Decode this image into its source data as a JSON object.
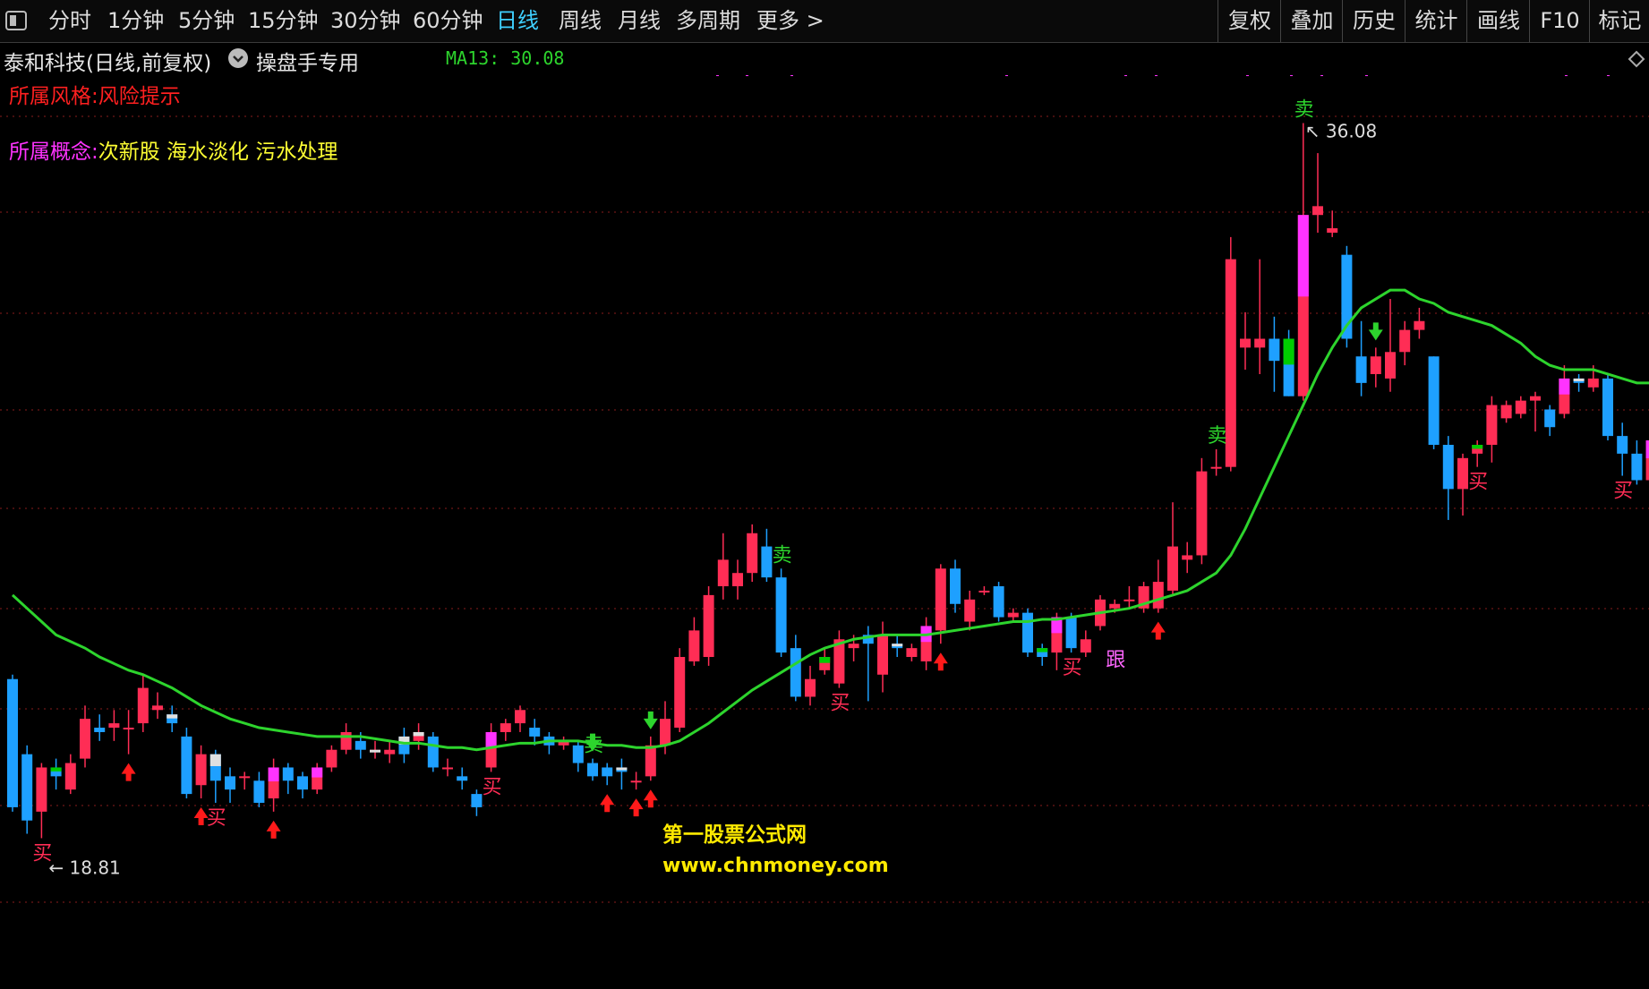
{
  "toolbar": {
    "periods": [
      "分时",
      "1分钟",
      "5分钟",
      "15分钟",
      "30分钟",
      "60分钟",
      "日线",
      "周线",
      "月线",
      "多周期",
      "更多 >"
    ],
    "active_period": "日线",
    "right_buttons": [
      "复权",
      "叠加",
      "历史",
      "统计",
      "画线",
      "F10",
      "标记"
    ]
  },
  "info": {
    "title": "泰和科技(日线,前复权)",
    "special": "操盘手专用",
    "ma_label": "MA13: 30.08"
  },
  "notes": {
    "style_prefix": "所属风格:",
    "style_value": "风险提示",
    "concept_prefix": "所属概念:",
    "concept_value": "次新股 海水淡化 污水处理"
  },
  "colors": {
    "up": "#ff2d55",
    "down": "#1ea0ff",
    "ma": "#2dd42d",
    "buy_arrow": "#ff1a1a",
    "sell_arrow": "#2dd42d",
    "grid": "#8a1c1c",
    "highlight_magenta": "#ff33ff",
    "highlight_green": "#00cc00"
  },
  "chart_data": {
    "type": "candlestick",
    "y_min": 17.5,
    "y_max": 38.5,
    "max_label": "36.08",
    "min_label": "18.81",
    "candles": [
      {
        "o": 23.5,
        "c": 20.6,
        "h": 23.6,
        "l": 20.5,
        "hl": null
      },
      {
        "o": 21.8,
        "c": 20.3,
        "h": 22.0,
        "l": 20.0,
        "hl": null
      },
      {
        "o": 20.5,
        "c": 21.5,
        "h": 21.6,
        "l": 19.9,
        "hl": null
      },
      {
        "o": 21.5,
        "c": 21.3,
        "h": 21.7,
        "l": 21.0,
        "hl": "green"
      },
      {
        "o": 21.0,
        "c": 21.6,
        "h": 21.8,
        "l": 20.9,
        "hl": null
      },
      {
        "o": 21.7,
        "c": 22.6,
        "h": 22.9,
        "l": 21.5,
        "hl": null
      },
      {
        "o": 22.4,
        "c": 22.3,
        "h": 22.7,
        "l": 22.1,
        "hl": null
      },
      {
        "o": 22.4,
        "c": 22.5,
        "h": 22.8,
        "l": 22.1,
        "hl": null
      },
      {
        "o": 22.4,
        "c": 22.4,
        "h": 22.8,
        "l": 21.8,
        "hl": null
      },
      {
        "o": 22.5,
        "c": 23.3,
        "h": 23.6,
        "l": 22.3,
        "hl": null
      },
      {
        "o": 22.8,
        "c": 22.9,
        "h": 23.2,
        "l": 22.6,
        "hl": null
      },
      {
        "o": 22.7,
        "c": 22.5,
        "h": 22.9,
        "l": 22.3,
        "hl": "white"
      },
      {
        "o": 22.2,
        "c": 20.9,
        "h": 22.4,
        "l": 20.8,
        "hl": null
      },
      {
        "o": 21.1,
        "c": 21.8,
        "h": 22.0,
        "l": 20.8,
        "hl": null
      },
      {
        "o": 21.8,
        "c": 21.2,
        "h": 21.9,
        "l": 20.7,
        "hl": "white"
      },
      {
        "o": 21.3,
        "c": 21.0,
        "h": 21.5,
        "l": 20.7,
        "hl": null
      },
      {
        "o": 21.3,
        "c": 21.3,
        "h": 21.4,
        "l": 21.0,
        "hl": null
      },
      {
        "o": 21.2,
        "c": 20.7,
        "h": 21.4,
        "l": 20.6,
        "hl": null
      },
      {
        "o": 20.8,
        "c": 21.5,
        "h": 21.7,
        "l": 20.5,
        "hl": "magenta"
      },
      {
        "o": 21.5,
        "c": 21.2,
        "h": 21.6,
        "l": 20.9,
        "hl": null
      },
      {
        "o": 21.3,
        "c": 21.0,
        "h": 21.4,
        "l": 20.8,
        "hl": null
      },
      {
        "o": 21.0,
        "c": 21.5,
        "h": 21.6,
        "l": 20.9,
        "hl": "magenta"
      },
      {
        "o": 21.5,
        "c": 21.9,
        "h": 22.0,
        "l": 21.4,
        "hl": null
      },
      {
        "o": 21.9,
        "c": 22.3,
        "h": 22.5,
        "l": 21.8,
        "hl": null
      },
      {
        "o": 22.1,
        "c": 21.9,
        "h": 22.3,
        "l": 21.7,
        "hl": null
      },
      {
        "o": 21.9,
        "c": 21.9,
        "h": 22.1,
        "l": 21.7,
        "hl": "white"
      },
      {
        "o": 21.8,
        "c": 21.9,
        "h": 22.1,
        "l": 21.6,
        "hl": null
      },
      {
        "o": 22.2,
        "c": 21.8,
        "h": 22.4,
        "l": 21.6,
        "hl": "white"
      },
      {
        "o": 22.1,
        "c": 22.3,
        "h": 22.5,
        "l": 21.9,
        "hl": "white"
      },
      {
        "o": 22.2,
        "c": 21.5,
        "h": 22.3,
        "l": 21.4,
        "hl": null
      },
      {
        "o": 21.5,
        "c": 21.5,
        "h": 21.7,
        "l": 21.3,
        "hl": null
      },
      {
        "o": 21.3,
        "c": 21.2,
        "h": 21.5,
        "l": 21.0,
        "hl": null
      },
      {
        "o": 20.9,
        "c": 20.6,
        "h": 21.0,
        "l": 20.4,
        "hl": null
      },
      {
        "o": 21.5,
        "c": 22.3,
        "h": 22.5,
        "l": 21.4,
        "hl": "magenta"
      },
      {
        "o": 22.3,
        "c": 22.5,
        "h": 22.6,
        "l": 22.1,
        "hl": null
      },
      {
        "o": 22.5,
        "c": 22.8,
        "h": 22.9,
        "l": 22.3,
        "hl": null
      },
      {
        "o": 22.4,
        "c": 22.2,
        "h": 22.6,
        "l": 22.0,
        "hl": null
      },
      {
        "o": 22.2,
        "c": 22.0,
        "h": 22.3,
        "l": 21.8,
        "hl": null
      },
      {
        "o": 22.0,
        "c": 22.1,
        "h": 22.2,
        "l": 21.9,
        "hl": null
      },
      {
        "o": 22.0,
        "c": 21.6,
        "h": 22.1,
        "l": 21.4,
        "hl": null
      },
      {
        "o": 21.6,
        "c": 21.3,
        "h": 21.7,
        "l": 21.2,
        "hl": null
      },
      {
        "o": 21.5,
        "c": 21.3,
        "h": 21.6,
        "l": 21.1,
        "hl": null
      },
      {
        "o": 21.5,
        "c": 21.4,
        "h": 21.7,
        "l": 21.0,
        "hl": "white"
      },
      {
        "o": 21.2,
        "c": 21.2,
        "h": 21.4,
        "l": 21.0,
        "hl": null
      },
      {
        "o": 21.3,
        "c": 22.0,
        "h": 22.2,
        "l": 21.2,
        "hl": null
      },
      {
        "o": 22.0,
        "c": 22.6,
        "h": 23.0,
        "l": 21.8,
        "hl": null
      },
      {
        "o": 22.4,
        "c": 24.0,
        "h": 24.2,
        "l": 22.3,
        "hl": null
      },
      {
        "o": 23.9,
        "c": 24.6,
        "h": 24.9,
        "l": 23.8,
        "hl": null
      },
      {
        "o": 24.0,
        "c": 25.4,
        "h": 25.6,
        "l": 23.8,
        "hl": null
      },
      {
        "o": 25.6,
        "c": 26.2,
        "h": 26.8,
        "l": 25.3,
        "hl": null
      },
      {
        "o": 25.6,
        "c": 25.9,
        "h": 26.2,
        "l": 25.3,
        "hl": null
      },
      {
        "o": 25.9,
        "c": 26.8,
        "h": 27.0,
        "l": 25.7,
        "hl": null
      },
      {
        "o": 26.5,
        "c": 25.8,
        "h": 26.9,
        "l": 25.7,
        "hl": null
      },
      {
        "o": 25.8,
        "c": 24.1,
        "h": 26.0,
        "l": 24.0,
        "hl": null
      },
      {
        "o": 24.2,
        "c": 23.1,
        "h": 24.5,
        "l": 23.0,
        "hl": null
      },
      {
        "o": 23.1,
        "c": 23.5,
        "h": 23.8,
        "l": 22.9,
        "hl": null
      },
      {
        "o": 23.7,
        "c": 24.0,
        "h": 24.2,
        "l": 23.6,
        "hl": "green"
      },
      {
        "o": 23.4,
        "c": 24.4,
        "h": 24.6,
        "l": 23.3,
        "hl": null
      },
      {
        "o": 24.2,
        "c": 24.3,
        "h": 24.5,
        "l": 23.9,
        "hl": null
      },
      {
        "o": 24.5,
        "c": 24.3,
        "h": 24.7,
        "l": 23.0,
        "hl": null
      },
      {
        "o": 23.6,
        "c": 24.5,
        "h": 24.8,
        "l": 23.2,
        "hl": null
      },
      {
        "o": 24.3,
        "c": 24.2,
        "h": 24.5,
        "l": 24.0,
        "hl": "white"
      },
      {
        "o": 24.0,
        "c": 24.2,
        "h": 24.3,
        "l": 23.9,
        "hl": null
      },
      {
        "o": 23.9,
        "c": 24.7,
        "h": 24.9,
        "l": 23.7,
        "hl": "magenta"
      },
      {
        "o": 24.6,
        "c": 26.0,
        "h": 26.1,
        "l": 24.3,
        "hl": null
      },
      {
        "o": 26.0,
        "c": 25.2,
        "h": 26.2,
        "l": 25.0,
        "hl": null
      },
      {
        "o": 24.8,
        "c": 25.3,
        "h": 25.5,
        "l": 24.6,
        "hl": null
      },
      {
        "o": 25.5,
        "c": 25.5,
        "h": 25.6,
        "l": 25.4,
        "hl": null
      },
      {
        "o": 25.6,
        "c": 24.9,
        "h": 25.7,
        "l": 24.8,
        "hl": null
      },
      {
        "o": 24.9,
        "c": 25.0,
        "h": 25.1,
        "l": 24.8,
        "hl": null
      },
      {
        "o": 25.0,
        "c": 24.1,
        "h": 25.1,
        "l": 24.0,
        "hl": null
      },
      {
        "o": 24.2,
        "c": 24.0,
        "h": 24.3,
        "l": 23.8,
        "hl": "green"
      },
      {
        "o": 24.1,
        "c": 24.9,
        "h": 25.0,
        "l": 23.7,
        "hl": "magenta"
      },
      {
        "o": 24.9,
        "c": 24.2,
        "h": 25.0,
        "l": 24.1,
        "hl": null
      },
      {
        "o": 24.1,
        "c": 24.4,
        "h": 24.6,
        "l": 24.0,
        "hl": null
      },
      {
        "o": 24.7,
        "c": 25.3,
        "h": 25.4,
        "l": 24.6,
        "hl": null
      },
      {
        "o": 25.1,
        "c": 25.2,
        "h": 25.3,
        "l": 25.0,
        "hl": null
      },
      {
        "o": 25.3,
        "c": 25.3,
        "h": 25.6,
        "l": 25.1,
        "hl": null
      },
      {
        "o": 25.1,
        "c": 25.6,
        "h": 25.7,
        "l": 25.0,
        "hl": null
      },
      {
        "o": 25.1,
        "c": 25.7,
        "h": 26.2,
        "l": 25.0,
        "hl": null
      },
      {
        "o": 25.5,
        "c": 26.5,
        "h": 27.5,
        "l": 25.4,
        "hl": null
      },
      {
        "o": 26.2,
        "c": 26.3,
        "h": 26.6,
        "l": 25.9,
        "hl": null
      },
      {
        "o": 26.3,
        "c": 28.2,
        "h": 28.5,
        "l": 26.1,
        "hl": null
      },
      {
        "o": 28.3,
        "c": 28.3,
        "h": 28.7,
        "l": 28.1,
        "hl": null
      },
      {
        "o": 28.3,
        "c": 33.0,
        "h": 33.5,
        "l": 28.2,
        "hl": null
      },
      {
        "o": 31.0,
        "c": 31.2,
        "h": 31.8,
        "l": 30.5,
        "hl": null
      },
      {
        "o": 31.0,
        "c": 31.2,
        "h": 33.0,
        "l": 30.4,
        "hl": null
      },
      {
        "o": 31.2,
        "c": 30.7,
        "h": 31.7,
        "l": 30.0,
        "hl": null
      },
      {
        "o": 31.2,
        "c": 29.9,
        "h": 31.4,
        "l": 29.9,
        "hl": "green"
      },
      {
        "o": 29.9,
        "c": 34.0,
        "h": 36.08,
        "l": 29.8,
        "hl": "magenta"
      },
      {
        "o": 34.0,
        "c": 34.2,
        "h": 35.4,
        "l": 33.6,
        "hl": null
      },
      {
        "o": 33.6,
        "c": 33.7,
        "h": 34.1,
        "l": 33.5,
        "hl": null
      },
      {
        "o": 33.1,
        "c": 31.2,
        "h": 33.3,
        "l": 31.0,
        "hl": null
      },
      {
        "o": 30.8,
        "c": 30.2,
        "h": 31.6,
        "l": 29.9,
        "hl": null
      },
      {
        "o": 30.4,
        "c": 30.8,
        "h": 31.0,
        "l": 30.1,
        "hl": null
      },
      {
        "o": 30.3,
        "c": 30.9,
        "h": 32.1,
        "l": 30.0,
        "hl": null
      },
      {
        "o": 30.9,
        "c": 31.4,
        "h": 31.6,
        "l": 30.6,
        "hl": null
      },
      {
        "o": 31.4,
        "c": 31.6,
        "h": 31.9,
        "l": 31.2,
        "hl": null
      },
      {
        "o": 30.8,
        "c": 28.8,
        "h": 30.8,
        "l": 28.7,
        "hl": null
      },
      {
        "o": 28.8,
        "c": 27.8,
        "h": 29.0,
        "l": 27.1,
        "hl": null
      },
      {
        "o": 27.8,
        "c": 28.5,
        "h": 28.6,
        "l": 27.2,
        "hl": null
      },
      {
        "o": 28.6,
        "c": 28.8,
        "h": 28.9,
        "l": 28.3,
        "hl": "green"
      },
      {
        "o": 28.8,
        "c": 29.7,
        "h": 29.9,
        "l": 28.4,
        "hl": null
      },
      {
        "o": 29.4,
        "c": 29.7,
        "h": 29.8,
        "l": 29.3,
        "hl": null
      },
      {
        "o": 29.5,
        "c": 29.8,
        "h": 29.9,
        "l": 29.4,
        "hl": null
      },
      {
        "o": 29.8,
        "c": 29.9,
        "h": 30.0,
        "l": 29.1,
        "hl": null
      },
      {
        "o": 29.6,
        "c": 29.2,
        "h": 29.7,
        "l": 29.0,
        "hl": null
      },
      {
        "o": 29.5,
        "c": 30.3,
        "h": 30.6,
        "l": 29.4,
        "hl": "magenta"
      },
      {
        "o": 30.3,
        "c": 30.2,
        "h": 30.4,
        "l": 30.0,
        "hl": "white"
      },
      {
        "o": 30.1,
        "c": 30.3,
        "h": 30.6,
        "l": 30.0,
        "hl": null
      },
      {
        "o": 30.3,
        "c": 29.0,
        "h": 30.4,
        "l": 28.9,
        "hl": null
      },
      {
        "o": 29.0,
        "c": 28.6,
        "h": 29.3,
        "l": 28.1,
        "hl": null
      },
      {
        "o": 28.6,
        "c": 28.0,
        "h": 28.9,
        "l": 27.9,
        "hl": null
      },
      {
        "o": 28.0,
        "c": 28.9,
        "h": 29.0,
        "l": 27.8,
        "hl": "magenta"
      },
      {
        "o": 29.0,
        "c": 29.0,
        "h": 29.1,
        "l": 28.5,
        "hl": null
      },
      {
        "o": 29.0,
        "c": 29.9,
        "h": 30.0,
        "l": 28.9,
        "hl": null
      }
    ],
    "ma13": [
      25.4,
      25.1,
      24.8,
      24.5,
      24.35,
      24.2,
      24.0,
      23.85,
      23.7,
      23.6,
      23.45,
      23.3,
      23.1,
      22.9,
      22.75,
      22.6,
      22.5,
      22.4,
      22.35,
      22.3,
      22.25,
      22.2,
      22.2,
      22.2,
      22.2,
      22.15,
      22.1,
      22.05,
      22.05,
      22.0,
      21.95,
      21.95,
      21.9,
      21.95,
      22.0,
      22.05,
      22.05,
      22.1,
      22.1,
      22.1,
      22.05,
      22.0,
      22.0,
      21.95,
      21.95,
      22.0,
      22.1,
      22.3,
      22.5,
      22.75,
      23.0,
      23.25,
      23.45,
      23.65,
      23.85,
      24.05,
      24.2,
      24.3,
      24.4,
      24.45,
      24.5,
      24.5,
      24.5,
      24.5,
      24.55,
      24.6,
      24.65,
      24.7,
      24.75,
      24.8,
      24.8,
      24.85,
      24.85,
      24.9,
      24.95,
      25.0,
      25.05,
      25.1,
      25.2,
      25.3,
      25.4,
      25.5,
      25.7,
      25.9,
      26.3,
      26.9,
      27.6,
      28.3,
      29.0,
      29.7,
      30.4,
      31.0,
      31.5,
      31.9,
      32.1,
      32.3,
      32.3,
      32.1,
      32.0,
      31.8,
      31.7,
      31.6,
      31.5,
      31.3,
      31.1,
      30.8,
      30.6,
      30.5,
      30.5,
      30.5,
      30.4,
      30.3,
      30.2,
      30.2,
      30.3,
      30.4,
      30.5
    ]
  },
  "signals": {
    "buy_arrows": [
      8,
      13,
      18,
      41,
      43,
      44,
      64,
      79
    ],
    "sell_arrows": [
      40,
      44,
      94
    ],
    "buy_text_label": "买",
    "sell_text_label": "卖",
    "follow_text_label": "跟",
    "buy_texts": [
      2,
      14,
      33,
      57,
      73,
      101,
      111
    ],
    "sell_texts": [
      40,
      53,
      83,
      89
    ],
    "follow_texts": [
      76
    ]
  },
  "watermark": {
    "line1": "第一股票公式网",
    "line2": "www.chnmoney.com"
  }
}
